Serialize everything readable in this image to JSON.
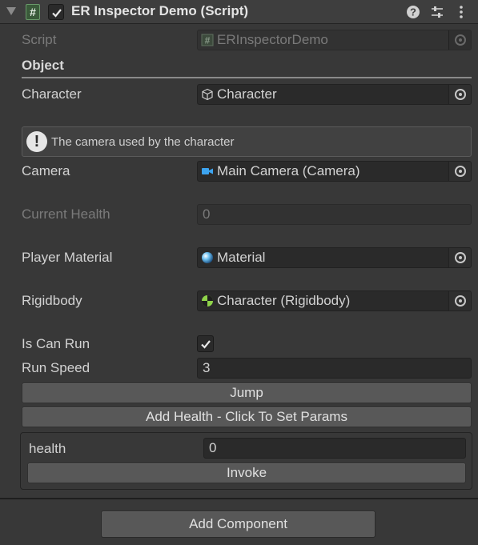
{
  "header": {
    "title": "ER Inspector Demo (Script)",
    "script_icon": "#",
    "icons": [
      "help-icon",
      "presets-icon",
      "more-icon"
    ]
  },
  "script": {
    "label": "Script",
    "value": "ERInspectorDemo"
  },
  "section": {
    "title": "Object"
  },
  "character": {
    "label": "Character",
    "value": "Character"
  },
  "help": {
    "text": "The camera used by the character"
  },
  "camera": {
    "label": "Camera",
    "value": "Main Camera (Camera)"
  },
  "current_health": {
    "label": "Current Health",
    "value": "0"
  },
  "player_material": {
    "label": "Player Material",
    "value": "Material"
  },
  "rigidbody": {
    "label": "Rigidbody",
    "value": "Character (Rigidbody)"
  },
  "is_can_run": {
    "label": "Is Can Run",
    "checked": true
  },
  "run_speed": {
    "label": "Run Speed",
    "value": "3"
  },
  "buttons": {
    "jump": "Jump",
    "add_health": "Add Health - Click To Set Params"
  },
  "params": {
    "health_label": "health",
    "health_value": "0",
    "invoke": "Invoke"
  },
  "footer": {
    "add_component": "Add Component"
  },
  "colors": {
    "background": "#383838",
    "field": "#2a2a2a",
    "button": "#585858",
    "camera_icon": "#3da4f0",
    "rigidbody_icon": "#8fd34a"
  }
}
